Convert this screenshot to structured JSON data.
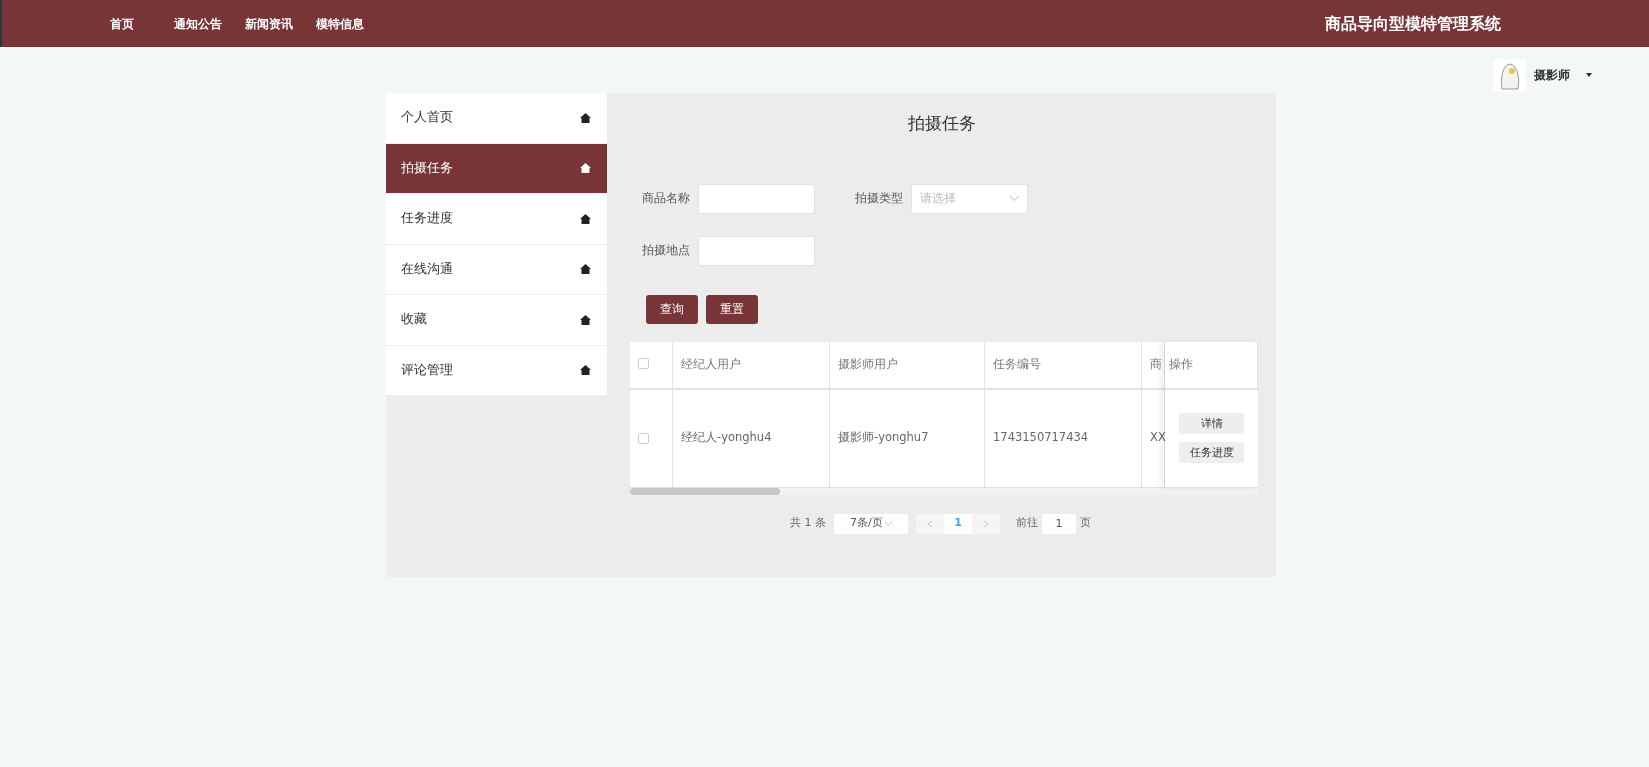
{
  "nav": {
    "links": [
      {
        "label": "首页"
      },
      {
        "label": "通知公告"
      },
      {
        "label": "新闻资讯"
      },
      {
        "label": "模特信息"
      }
    ],
    "brand": "商品导向型模特管理系统"
  },
  "user": {
    "name": "摄影师"
  },
  "sidebar": {
    "items": [
      {
        "label": "个人首页",
        "selected": false
      },
      {
        "label": "拍摄任务",
        "selected": true
      },
      {
        "label": "任务进度",
        "selected": false
      },
      {
        "label": "在线沟通",
        "selected": false
      },
      {
        "label": "收藏",
        "selected": false
      },
      {
        "label": "评论管理",
        "selected": false
      }
    ]
  },
  "page_title": "拍摄任务",
  "filters": [
    {
      "kind": "text",
      "label": "商品名称"
    },
    {
      "kind": "select",
      "label": "拍摄类型",
      "placeholder": "请选择"
    },
    {
      "kind": "text",
      "label": "拍摄地点"
    }
  ],
  "buttons": [
    "查询",
    "重置"
  ],
  "table": {
    "all_selected": false,
    "columns": [
      "经纪人用户",
      "摄影师用户",
      "任务编号",
      "商"
    ],
    "action_column": "操作",
    "rows": [
      {
        "selected": false,
        "cells": [
          "经纪人-yonghu4",
          "摄影师-yonghu7",
          "1743150717434",
          "XX"
        ],
        "actions": [
          "详情",
          "任务进度"
        ]
      }
    ]
  },
  "pagination": {
    "total": "共 1 条",
    "page_size": "7条/页",
    "pages": [
      {
        "label": "1",
        "selected": true
      }
    ],
    "goto_label": "前往",
    "goto_value": "1",
    "goto_suffix": "页"
  }
}
